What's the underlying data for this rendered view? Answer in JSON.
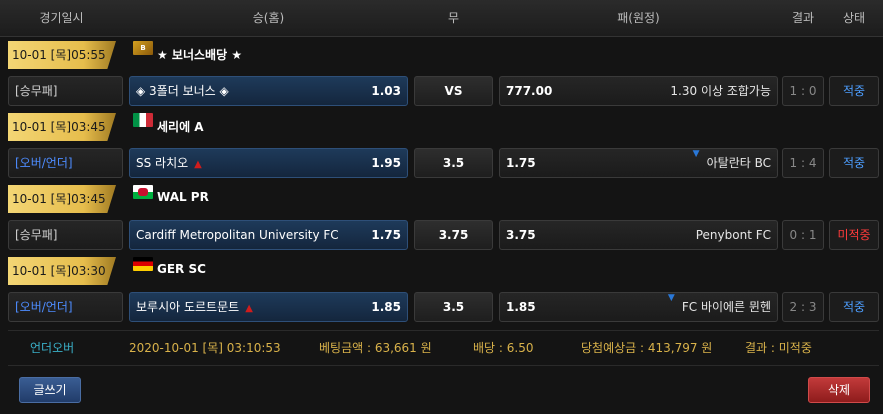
{
  "header": {
    "date": "경기일시",
    "home": "승(홈)",
    "draw": "무",
    "away": "패(원정)",
    "result": "결과",
    "status": "상태"
  },
  "rows": [
    {
      "date": "10-01 [목]05:55",
      "league": "★ 보너스배당 ★",
      "league_icon": "bonus-icon",
      "type": "[승무패]",
      "type_color": "#d0d0d0",
      "home": "◈ 3폴더 보너스 ◈",
      "home_odd": "1.03",
      "draw": "VS",
      "away_odd": "777.00",
      "away": "1.30 이상 조합가능",
      "result": "1 : 0",
      "status": "적중"
    },
    {
      "date": "10-01 [목]03:45",
      "league": "세리에 A",
      "league_icon": "italy-flag-icon",
      "type": "[오버/언더]",
      "type_color": "#4d8cff",
      "home": "SS 라치오",
      "home_odd": "1.95",
      "draw": "3.5",
      "away_odd": "1.75",
      "away": "아탈란타 BC",
      "result": "1 : 4",
      "status": "적중"
    },
    {
      "date": "10-01 [목]03:45",
      "league": "WAL PR",
      "league_icon": "wales-flag-icon",
      "type": "[승무패]",
      "type_color": "#d0d0d0",
      "home": "Cardiff Metropolitan University FC",
      "home_odd": "1.75",
      "draw": "3.75",
      "away_odd": "3.75",
      "away": "Penybont FC",
      "result": "0 : 1",
      "status": "미적중"
    },
    {
      "date": "10-01 [목]03:30",
      "league": "GER SC",
      "league_icon": "germany-flag-icon",
      "type": "[오버/언더]",
      "type_color": "#4d8cff",
      "home": "보루시아 도르트문트",
      "home_odd": "1.85",
      "draw": "3.5",
      "away_odd": "1.85",
      "away": "FC 바이에른 뮌헨",
      "result": "2 : 3",
      "status": "적중"
    }
  ],
  "summary": {
    "type": "언더오버",
    "datetime": "2020-10-01 [목] 03:10:53",
    "bet_amount": "베팅금액 : 63,661 원",
    "odds": "배당 : 6.50",
    "expected_win": "당첨예상금 : 413,797 원",
    "result": "결과 : 미적중"
  },
  "buttons": {
    "write": "글쓰기",
    "delete": "삭제"
  },
  "colors": {
    "accent_blue": "#4d9eff",
    "miss_red": "#ff3b3b",
    "gold": "#e6bd4c",
    "summary_teal": "#3ab0c8",
    "summary_gold": "#d9b24a"
  }
}
